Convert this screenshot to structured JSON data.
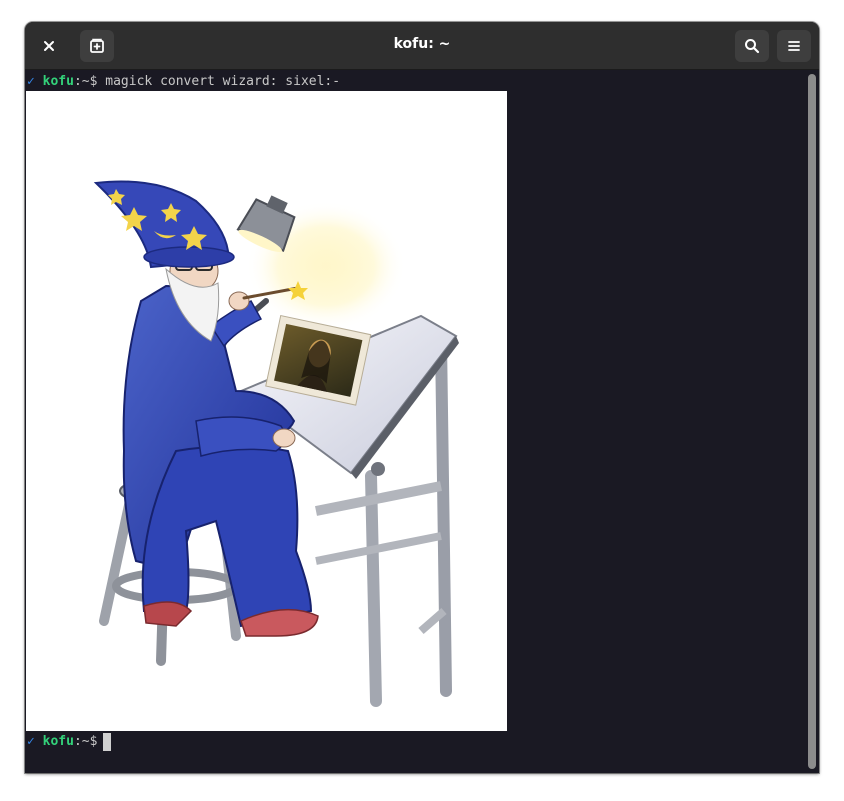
{
  "window": {
    "title": "kofu: ~",
    "buttons": {
      "close": "close-icon",
      "new_tab": "new-tab-icon",
      "search": "search-icon",
      "menu": "hamburger-menu-icon"
    }
  },
  "terminal": {
    "line1": {
      "status": "✓",
      "user": "kofu",
      "sep": ":",
      "path": "~",
      "prompt": "$",
      "command": " magick convert wizard: sixel:-"
    },
    "line2": {
      "status": "✓",
      "user": "kofu",
      "sep": ":",
      "path": "~",
      "prompt": "$"
    },
    "image": {
      "subject": "wizard-illustration"
    }
  },
  "colors": {
    "background": "#1a1923",
    "titlebar": "#2e2e2e",
    "prompt_user": "#33d17a",
    "status_check": "#3584e4",
    "text": "#c8c8c8"
  }
}
